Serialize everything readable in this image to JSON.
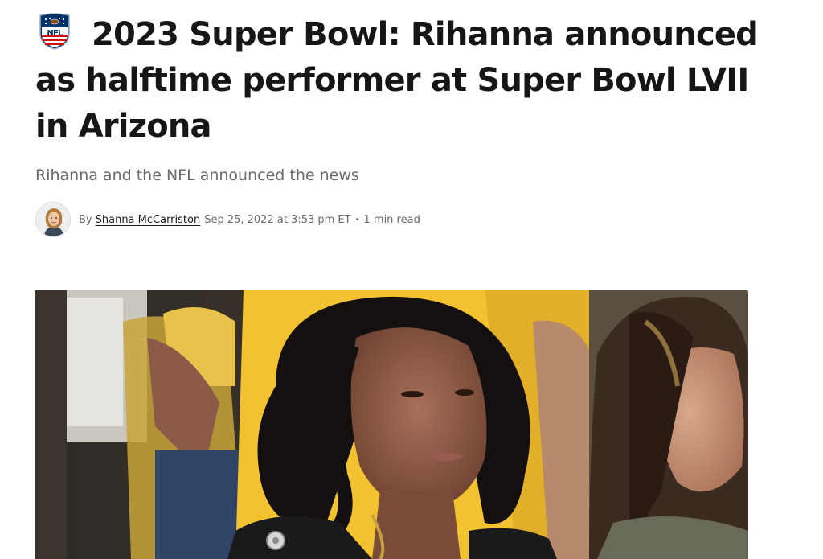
{
  "article": {
    "league_logo_icon": "nfl-shield-icon",
    "league_logo_text": "NFL",
    "title": "2023 Super Bowl: Rihanna announced as halftime performer at Super Bowl LVII in Arizona",
    "subtitle": "Rihanna and the NFL announced the news",
    "byline": {
      "by_label": "By",
      "author": "Shanna McCarriston",
      "date": "Sep 25, 2022 at 3:53 pm ET",
      "separator": "•",
      "read_time": "1 min read"
    }
  },
  "colors": {
    "title": "#161616",
    "subtitle": "#6a6a6a",
    "nfl_blue": "#013369",
    "nfl_red": "#d50a0a",
    "crowd_yellow": "#f2c230"
  }
}
